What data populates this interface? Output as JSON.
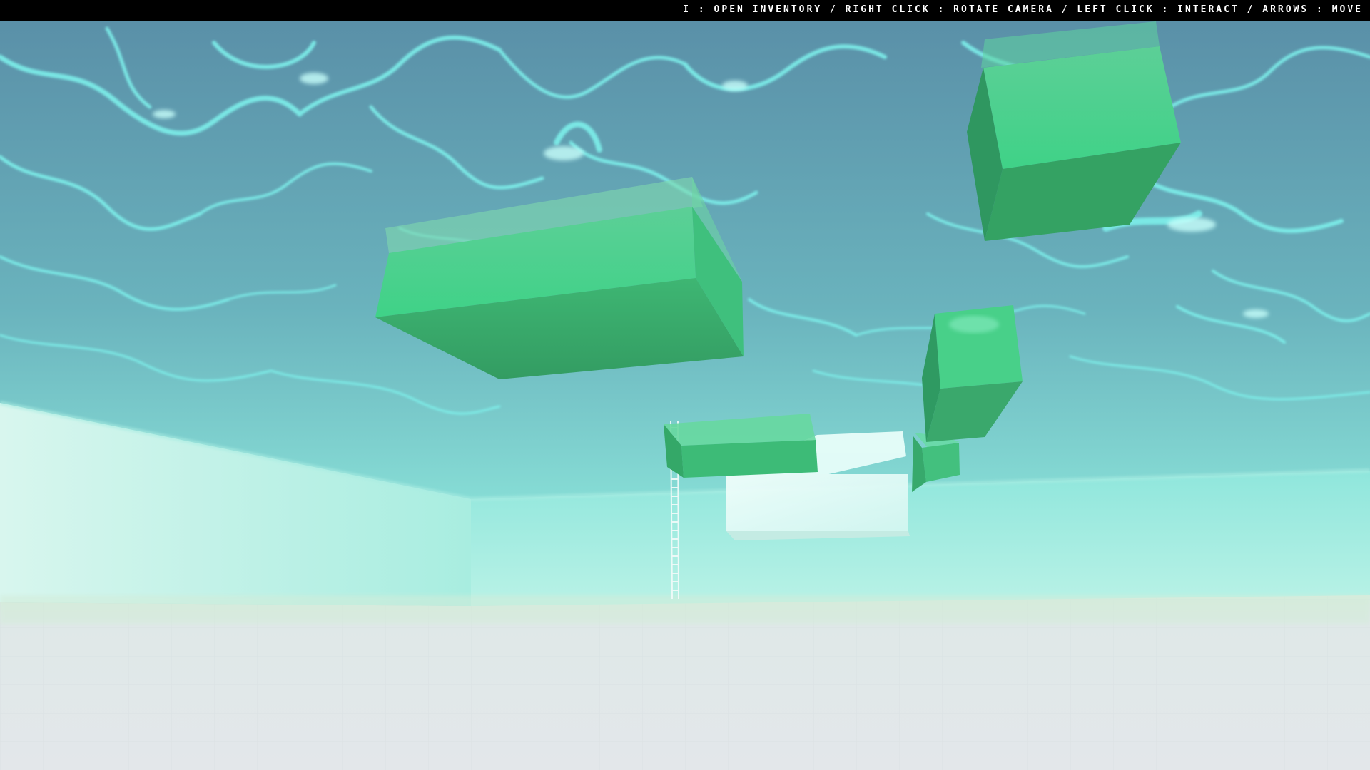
{
  "hud": {
    "controls_hint": "I : OPEN INVENTORY / RIGHT CLICK : ROTATE CAMERA / LEFT CLICK : INTERACT / ARROWS : MOVE"
  },
  "scene": {
    "environment": "underwater-pool",
    "colors": {
      "water_surface": "#5f98b0",
      "caustic_highlight": "#7ff4ee",
      "wall": "#b4f0e4",
      "floor": "#dde7ea",
      "block_top": "#47d88e",
      "block_front": "#3aa86c",
      "block_side": "#2f9a62",
      "crate": "#e7fbf8"
    },
    "objects": [
      {
        "name": "large-floating-block",
        "kind": "green-block"
      },
      {
        "name": "cube-top-right",
        "kind": "green-block"
      },
      {
        "name": "cube-mid-right",
        "kind": "green-block"
      },
      {
        "name": "small-block-center",
        "kind": "green-block"
      },
      {
        "name": "tiny-cube-right",
        "kind": "green-block"
      },
      {
        "name": "white-crate",
        "kind": "crate"
      },
      {
        "name": "pool-ladder",
        "kind": "ladder"
      }
    ]
  }
}
